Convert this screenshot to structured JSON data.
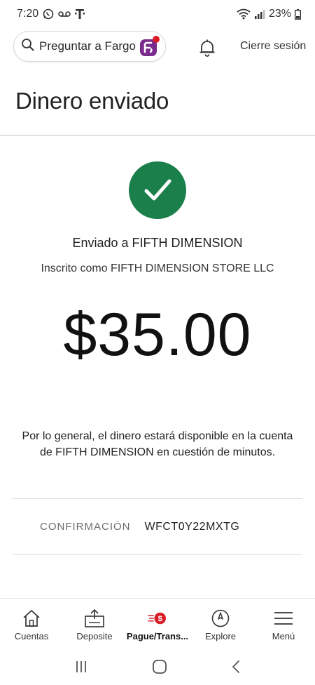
{
  "status_bar": {
    "time": "7:20",
    "battery": "23%"
  },
  "header": {
    "search_label": "Preguntar a Fargo",
    "logout_label": "Cierre sesión"
  },
  "page": {
    "title": "Dinero enviado"
  },
  "confirmation": {
    "sent_to": "Enviado a FIFTH DIMENSION",
    "registered_as": "Inscrito como FIFTH DIMENSION STORE LLC",
    "amount": "$35.00",
    "availability": "Por lo general, el dinero estará disponible en la cuenta de FIFTH DIMENSION en cuestión de minutos.",
    "confirmation_label": "CONFIRMACIÓN",
    "confirmation_number": "WFCT0Y22MXTG"
  },
  "bottom_nav": {
    "items": [
      {
        "label": "Cuentas",
        "icon": "home-icon"
      },
      {
        "label": "Deposite",
        "icon": "deposit-icon"
      },
      {
        "label": "Pague/Trans...",
        "icon": "pay-transfer-icon"
      },
      {
        "label": "Explore",
        "icon": "compass-icon"
      },
      {
        "label": "Menú",
        "icon": "hamburger-icon"
      }
    ]
  },
  "colors": {
    "success_green": "#1a7f4b",
    "accent_red": "#d71e28",
    "fargo_purple": "#7b2a8e"
  }
}
